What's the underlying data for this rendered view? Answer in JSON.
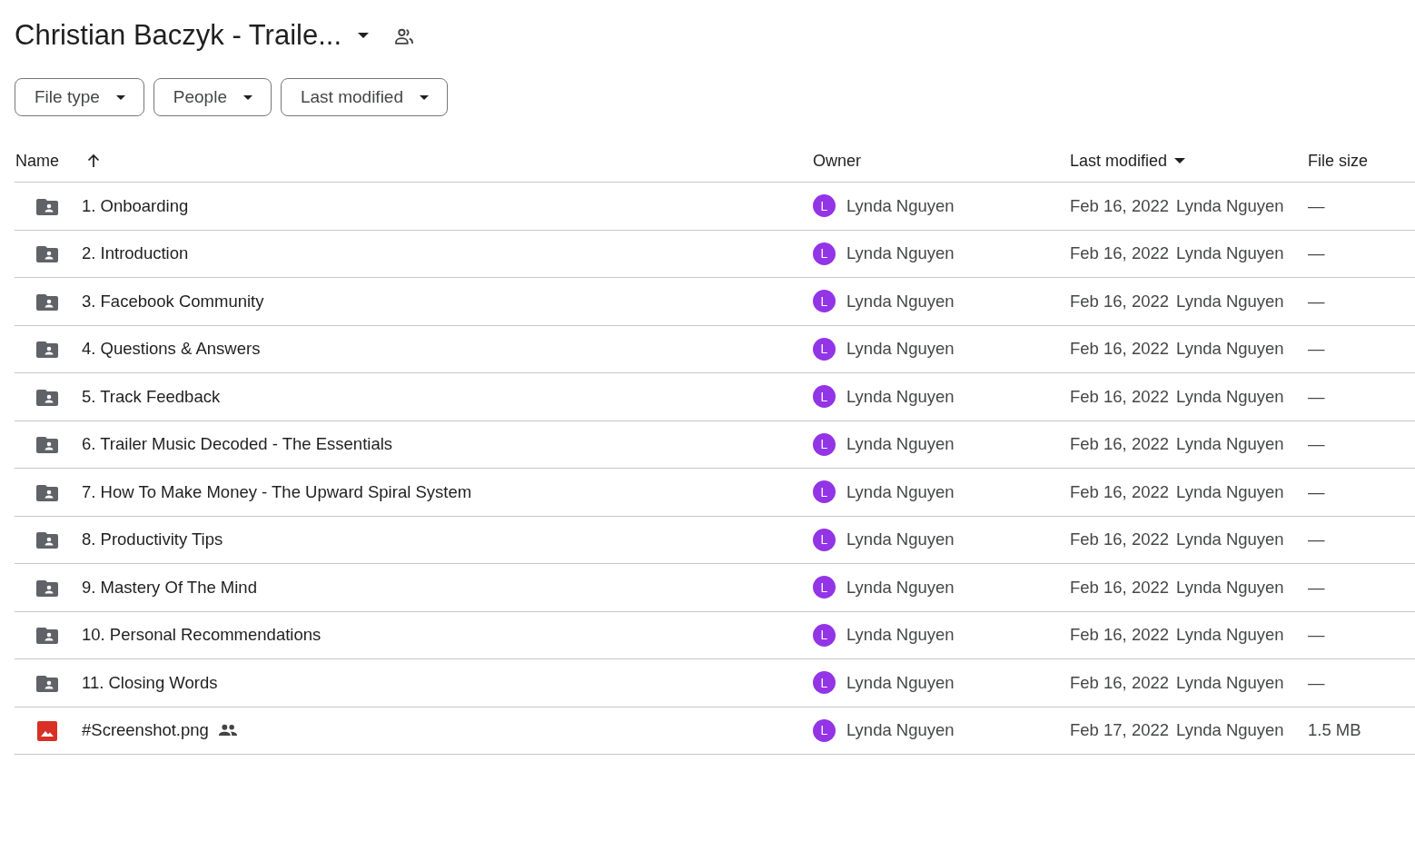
{
  "folder_title": "Christian Baczyk - Traile...",
  "filters": [
    {
      "label": "File type"
    },
    {
      "label": "People"
    },
    {
      "label": "Last modified"
    }
  ],
  "table": {
    "columns": [
      {
        "label": "Name",
        "sorted_ascending": true,
        "sorted_descending": false
      },
      {
        "label": "Owner",
        "sorted_ascending": false,
        "sorted_descending": false
      },
      {
        "label": "Last modified",
        "sorted_ascending": false,
        "sorted_descending": true
      },
      {
        "label": "File size",
        "sorted_ascending": false,
        "sorted_descending": false
      }
    ],
    "rows": [
      {
        "kind": "folder",
        "name": "1. Onboarding",
        "shared": false,
        "owner_initial": "L",
        "owner": "Lynda Nguyen",
        "modified_date": "Feb 16, 2022",
        "modified_by": "Lynda Nguyen",
        "size": "—"
      },
      {
        "kind": "folder",
        "name": "2. Introduction",
        "shared": false,
        "owner_initial": "L",
        "owner": "Lynda Nguyen",
        "modified_date": "Feb 16, 2022",
        "modified_by": "Lynda Nguyen",
        "size": "—"
      },
      {
        "kind": "folder",
        "name": "3. Facebook Community",
        "shared": false,
        "owner_initial": "L",
        "owner": "Lynda Nguyen",
        "modified_date": "Feb 16, 2022",
        "modified_by": "Lynda Nguyen",
        "size": "—"
      },
      {
        "kind": "folder",
        "name": "4. Questions & Answers",
        "shared": false,
        "owner_initial": "L",
        "owner": "Lynda Nguyen",
        "modified_date": "Feb 16, 2022",
        "modified_by": "Lynda Nguyen",
        "size": "—"
      },
      {
        "kind": "folder",
        "name": "5. Track Feedback",
        "shared": false,
        "owner_initial": "L",
        "owner": "Lynda Nguyen",
        "modified_date": "Feb 16, 2022",
        "modified_by": "Lynda Nguyen",
        "size": "—"
      },
      {
        "kind": "folder",
        "name": "6. Trailer Music Decoded - The Essentials",
        "shared": false,
        "owner_initial": "L",
        "owner": "Lynda Nguyen",
        "modified_date": "Feb 16, 2022",
        "modified_by": "Lynda Nguyen",
        "size": "—"
      },
      {
        "kind": "folder",
        "name": "7. How To Make Money - The Upward Spiral System",
        "shared": false,
        "owner_initial": "L",
        "owner": "Lynda Nguyen",
        "modified_date": "Feb 16, 2022",
        "modified_by": "Lynda Nguyen",
        "size": "—"
      },
      {
        "kind": "folder",
        "name": "8. Productivity Tips",
        "shared": false,
        "owner_initial": "L",
        "owner": "Lynda Nguyen",
        "modified_date": "Feb 16, 2022",
        "modified_by": "Lynda Nguyen",
        "size": "—"
      },
      {
        "kind": "folder",
        "name": "9. Mastery Of The Mind",
        "shared": false,
        "owner_initial": "L",
        "owner": "Lynda Nguyen",
        "modified_date": "Feb 16, 2022",
        "modified_by": "Lynda Nguyen",
        "size": "—"
      },
      {
        "kind": "folder",
        "name": "10. Personal Recommendations",
        "shared": false,
        "owner_initial": "L",
        "owner": "Lynda Nguyen",
        "modified_date": "Feb 16, 2022",
        "modified_by": "Lynda Nguyen",
        "size": "—"
      },
      {
        "kind": "folder",
        "name": "11. Closing Words",
        "shared": false,
        "owner_initial": "L",
        "owner": "Lynda Nguyen",
        "modified_date": "Feb 16, 2022",
        "modified_by": "Lynda Nguyen",
        "size": "—"
      },
      {
        "kind": "image",
        "name": "#Screenshot.png",
        "shared": true,
        "owner_initial": "L",
        "owner": "Lynda Nguyen",
        "modified_date": "Feb 17, 2022",
        "modified_by": "Lynda Nguyen",
        "size": "1.5 MB"
      }
    ]
  }
}
